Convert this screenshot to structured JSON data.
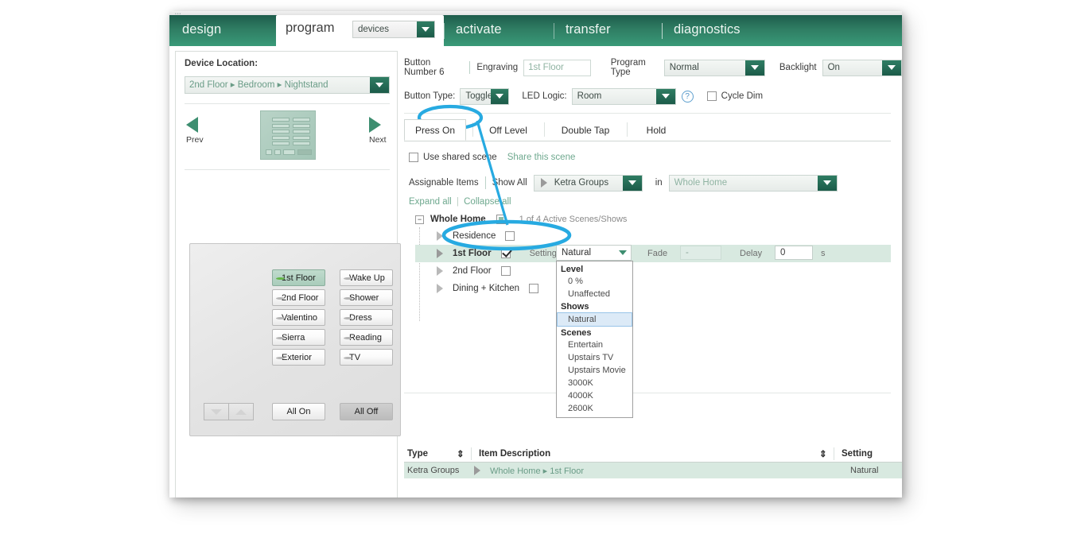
{
  "window": {
    "nav": {
      "tabs": [
        {
          "label": "design",
          "active": false
        },
        {
          "label": "program",
          "active": true
        },
        {
          "label": "activate",
          "active": false
        },
        {
          "label": "transfer",
          "active": false
        },
        {
          "label": "diagnostics",
          "active": false
        }
      ],
      "program_select": {
        "value": "devices",
        "icon": "chevron-down-icon"
      }
    }
  },
  "left_panel": {
    "device_location_label": "Device Location:",
    "device_location_value": "2nd Floor ▸ Bedroom ▸ Nightstand",
    "prev_label": "Prev",
    "next_label": "Next",
    "keypad": {
      "left_column": [
        "1st Floor",
        "2nd Floor",
        "Valentino",
        "Sierra",
        "Exterior"
      ],
      "right_column": [
        "Wake Up",
        "Shower",
        "Dress",
        "Reading",
        "TV"
      ],
      "selected_button": "1st Floor",
      "all_on_label": "All On",
      "all_off_label": "All Off"
    }
  },
  "right_panel": {
    "button_number_label": "Button Number 6",
    "engraving_label": "Engraving",
    "engraving_value": "1st Floor",
    "program_type_label": "Program Type",
    "program_type_value": "Normal",
    "backlight_label": "Backlight",
    "backlight_value": "On",
    "button_type_label": "Button Type:",
    "button_type_value": "Toggle",
    "led_logic_label": "LED Logic:",
    "led_logic_value": "Room",
    "help_icon_label": "?",
    "cycle_dim_label": "Cycle Dim",
    "tabs": [
      {
        "label": "Press On",
        "active": true
      },
      {
        "label": "Off Level",
        "active": false
      },
      {
        "label": "Double Tap",
        "active": false
      },
      {
        "label": "Hold",
        "active": false
      }
    ],
    "use_shared_scene_label": "Use shared scene",
    "share_this_scene_label": "Share this scene",
    "assignable_items_label": "Assignable Items",
    "show_all_label": "Show All",
    "show_all_value": "Ketra Groups",
    "in_label": "in",
    "in_value": "Whole Home",
    "expand_all_label": "Expand all",
    "collapse_all_label": "Collapse all",
    "tree": {
      "root": {
        "name": "Whole Home",
        "expander": "−",
        "checkbox_state": "indeterminate",
        "count_text": "1 of 4 Active Scenes/Shows"
      },
      "children": [
        {
          "name": "Residence",
          "checked": false,
          "selected": false
        },
        {
          "name": "1st Floor",
          "checked": true,
          "selected": true
        },
        {
          "name": "2nd Floor",
          "checked": false,
          "selected": false
        },
        {
          "name": "Dining + Kitchen",
          "checked": false,
          "selected": false
        }
      ]
    },
    "selected_row": {
      "setting_label": "Setting",
      "setting_value": "Natural",
      "fade_label": "Fade",
      "fade_value": "-",
      "delay_label": "Delay",
      "delay_value": "0",
      "delay_unit": "s"
    },
    "setting_dropdown": {
      "groups": [
        {
          "title": "Level",
          "items": [
            "0 %",
            "Unaffected"
          ]
        },
        {
          "title": "Shows",
          "items": [
            "Natural"
          ]
        },
        {
          "title": "Scenes",
          "items": [
            "Entertain",
            "Upstairs TV",
            "Upstairs Movie",
            "3000K",
            "4000K",
            "2600K"
          ]
        }
      ],
      "selected": "Natural"
    },
    "bottom_table": {
      "columns": [
        "Type",
        "Item Description",
        "Setting"
      ],
      "rows": [
        {
          "type": "Ketra Groups",
          "description": "Whole Home ▸ 1st Floor",
          "setting": "Natural"
        }
      ]
    }
  },
  "annotation": {
    "color": "#27AAE1",
    "shapes": [
      "ellipse-press-on-tab",
      "connector-line",
      "ellipse-1st-floor-row"
    ]
  },
  "colors": {
    "nav_green_dark": "#1d5c4b",
    "nav_green_light": "#399a78",
    "accent_green": "#3d8e70",
    "row_highlight": "#d8e9e0",
    "annotation_blue": "#27AAE1",
    "link_green": "#6fa98f"
  }
}
